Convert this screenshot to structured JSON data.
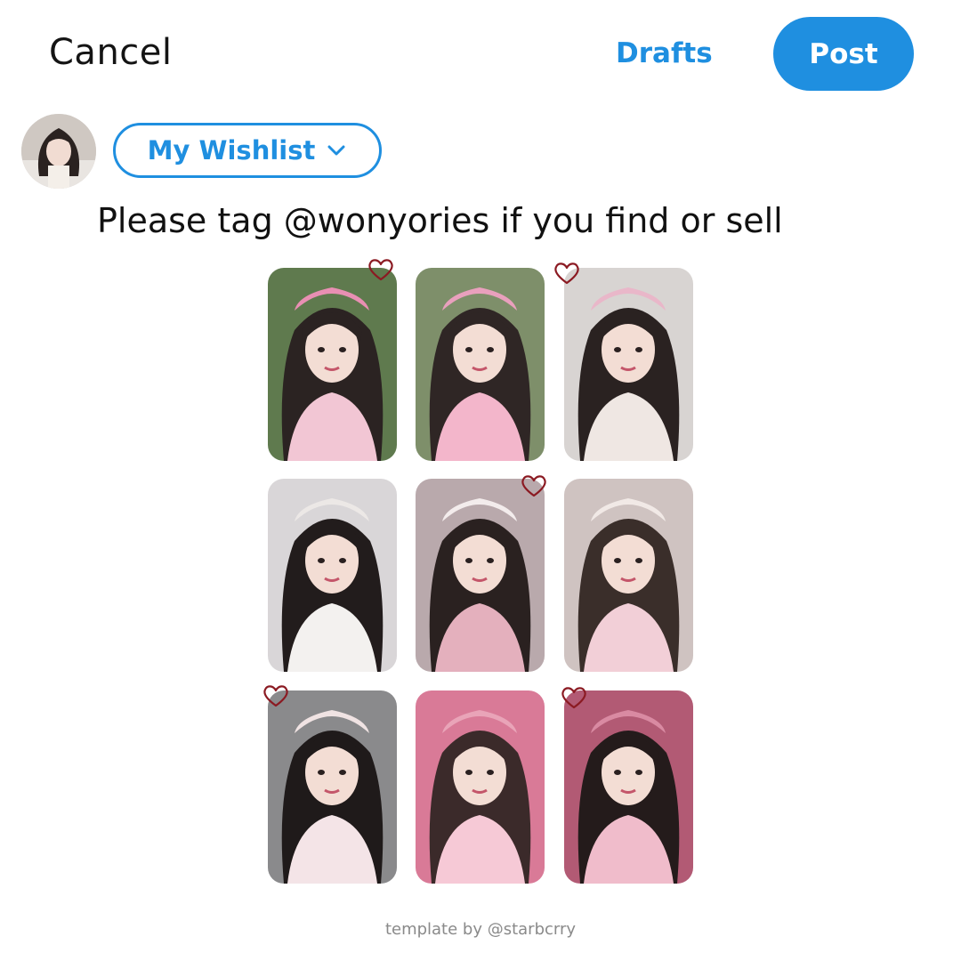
{
  "header": {
    "cancel_label": "Cancel",
    "drafts_label": "Drafts",
    "post_label": "Post"
  },
  "composer": {
    "audience_label": "My Wishlist",
    "text": "Please tag @wonyories if you find or sell"
  },
  "photocards": [
    {
      "label": "photocard 1",
      "hearted": true
    },
    {
      "label": "photocard 2",
      "hearted": false
    },
    {
      "label": "photocard 3",
      "hearted": true
    },
    {
      "label": "photocard 4",
      "hearted": false
    },
    {
      "label": "photocard 5",
      "hearted": true
    },
    {
      "label": "photocard 6",
      "hearted": false
    },
    {
      "label": "photocard 7",
      "hearted": true
    },
    {
      "label": "photocard 8",
      "hearted": false
    },
    {
      "label": "photocard 9",
      "hearted": true
    }
  ],
  "footer": {
    "credit": "template by @starbcrry"
  },
  "colors": {
    "accent": "#1f8fe0",
    "heart": "#8b1a22"
  }
}
